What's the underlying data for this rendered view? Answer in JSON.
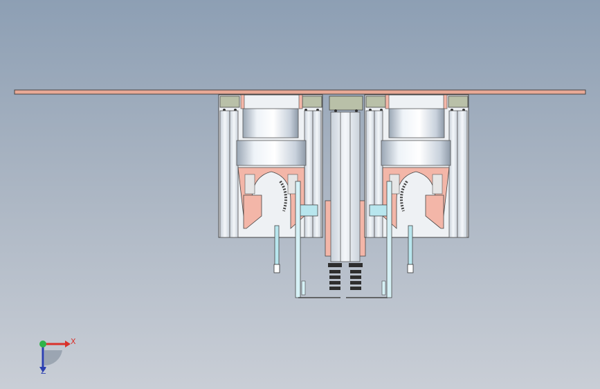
{
  "app": {
    "view": "cad-3d-viewport",
    "orientation": "front"
  },
  "colors": {
    "background_top": "#8d9fb4",
    "background_bottom": "#c9ced6",
    "plate": "#e8a996",
    "metal": "#dfe6ee",
    "metal_shade": "#9aa6b4",
    "copper": "#f3b6a8",
    "cyan_part": "#b8e6ee",
    "dark": "#2e2e2e",
    "x_axis": "#d9312b",
    "y_axis": "#2fb34a",
    "z_axis": "#2b3fb0"
  },
  "triad": {
    "x_label": "X",
    "z_label": "Z",
    "icon": "coordinate-triad-icon"
  }
}
